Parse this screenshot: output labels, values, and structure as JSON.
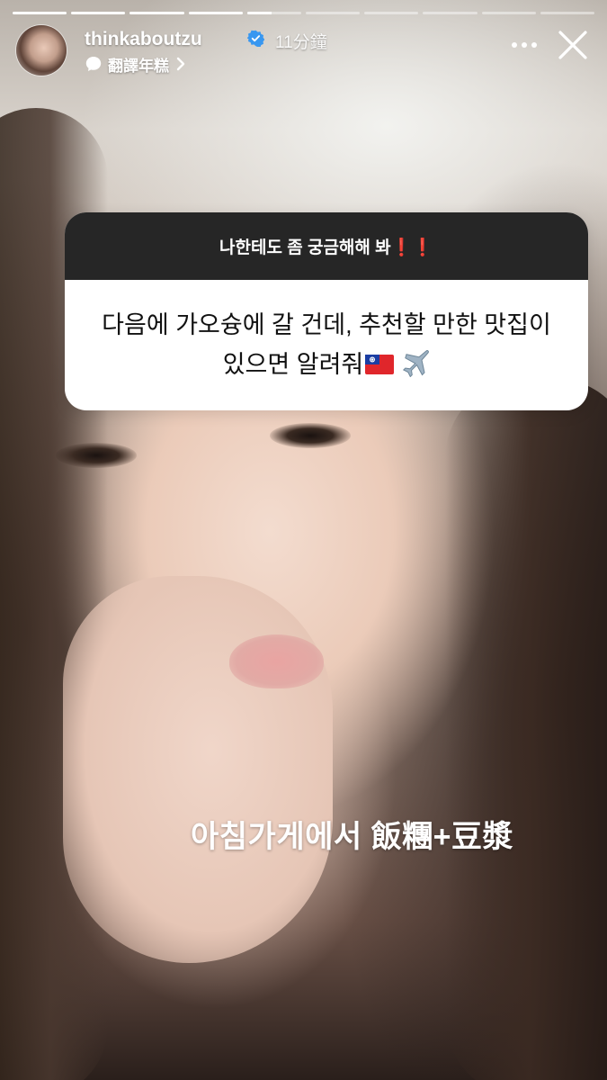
{
  "progress": {
    "segments": [
      1,
      1,
      1,
      1,
      0.45,
      0,
      0,
      0,
      0,
      0
    ]
  },
  "header": {
    "username": "thinkaboutzu",
    "time": "11分鐘",
    "translate_label": "翻譯年糕"
  },
  "question": {
    "title": "나한테도 좀 궁금해해 봐❗❗",
    "text": "다음에 가오슝에 갈 건데, 추천할 만한 맛집이 있으면 알려줘"
  },
  "answer": {
    "text": "아침가게에서 飯糰+豆漿"
  },
  "icons": {
    "verified": "verified-badge-icon",
    "speech": "speech-bubble-icon",
    "chevron": "chevron-right-icon",
    "more": "more-dots-icon",
    "close": "close-icon",
    "flag": "taiwan-flag-emoji",
    "plane": "airplane-emoji"
  },
  "colors": {
    "sticker_header": "#262626",
    "verified_blue": "#3897f0"
  }
}
